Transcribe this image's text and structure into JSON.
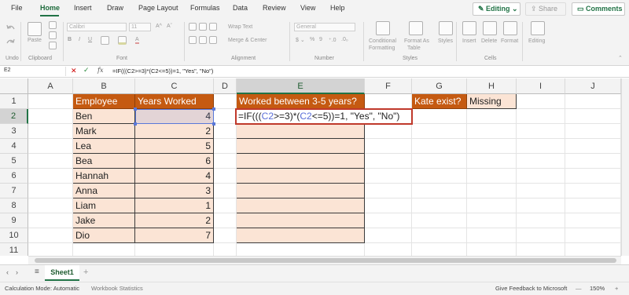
{
  "menu": {
    "items": [
      "File",
      "Home",
      "Insert",
      "Draw",
      "Page Layout",
      "Formulas",
      "Data",
      "Review",
      "View",
      "Help"
    ],
    "active": "Home"
  },
  "top_buttons": {
    "editing": "Editing",
    "share": "Share",
    "comments": "Comments"
  },
  "ribbon": {
    "groups": {
      "undo": "Undo",
      "clipboard": "Clipboard",
      "font": "Font",
      "alignment": "Alignment",
      "number": "Number",
      "styles": "Styles",
      "cells": "Cells"
    },
    "paste": "Paste",
    "font_name": "Calibri",
    "font_size": "11",
    "wrap_text": "Wrap Text",
    "merge_center": "Merge & Center",
    "number_format": "General",
    "conditional_formatting": [
      "Conditional",
      "Formatting"
    ],
    "format_as_table": [
      "Format As",
      "Table"
    ],
    "styles_btn": "Styles",
    "insert": "Insert",
    "delete": "Delete",
    "format": "Format",
    "editing": "Editing"
  },
  "formula_bar": {
    "name_box": "E2",
    "fx": "fx",
    "formula": "=IF(((C2>=3)*(C2<=5))=1, \"Yes\", \"No\")"
  },
  "columns": [
    "A",
    "B",
    "C",
    "D",
    "E",
    "F",
    "G",
    "H",
    "I",
    "J"
  ],
  "rows": [
    "1",
    "2",
    "3",
    "4",
    "5",
    "6",
    "7",
    "8",
    "9",
    "10",
    "11"
  ],
  "headers": {
    "employee": "Employee",
    "years_worked": "Years Worked",
    "worked_between": "Worked between 3-5 years?",
    "kate_exist": "Kate exist?",
    "missing": "Missing"
  },
  "employees": [
    {
      "name": "Ben",
      "years": "4"
    },
    {
      "name": "Mark",
      "years": "2"
    },
    {
      "name": "Lea",
      "years": "5"
    },
    {
      "name": "Bea",
      "years": "6"
    },
    {
      "name": "Hannah",
      "years": "4"
    },
    {
      "name": "Anna",
      "years": "3"
    },
    {
      "name": "Liam",
      "years": "1"
    },
    {
      "name": "Jake",
      "years": "2"
    },
    {
      "name": "Dio",
      "years": "7"
    }
  ],
  "edit_cell": {
    "parts": [
      "=IF(((",
      "C2",
      ">=3)*(",
      "C2",
      "<=5))=1, \"Yes\", \"No\")"
    ]
  },
  "sheet_tab": "Sheet1",
  "status": {
    "calc_mode": "Calculation Mode: Automatic",
    "workbook_stats": "Workbook Statistics",
    "feedback": "Give Feedback to Microsoft",
    "zoom": "150%"
  },
  "colors": {
    "accent": "#217346",
    "header_fill": "#c55a11",
    "data_fill": "#fbe4d5",
    "edit_border": "#c0392b",
    "ref_color": "#5b6fd8"
  }
}
